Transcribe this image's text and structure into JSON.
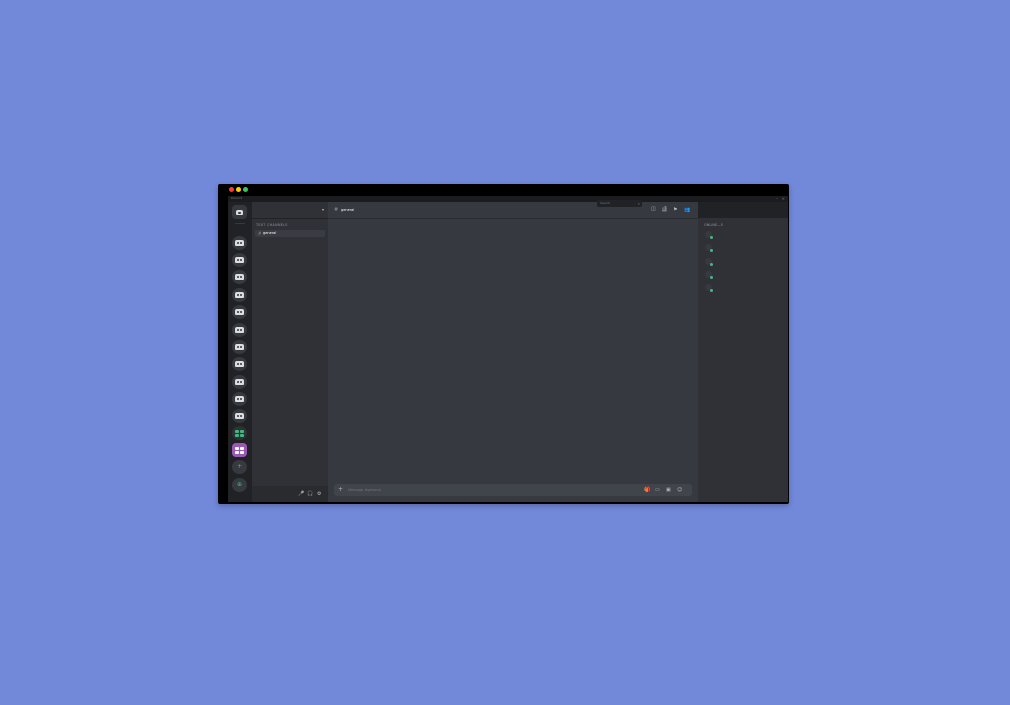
{
  "window": {
    "title": "Discord",
    "min_glyph": "–",
    "close_glyph": "×"
  },
  "guild_rail": {
    "home_icon": "discord-logo-icon",
    "guilds": [
      "server-1",
      "server-2",
      "server-3",
      "server-4",
      "server-5",
      "server-6",
      "server-7",
      "server-8",
      "server-9",
      "server-10",
      "server-11"
    ],
    "add_glyph": "+",
    "discover_glyph": "⊕"
  },
  "channels": {
    "chevron": "▾",
    "category": "TEXT CHANNELS",
    "selected_channel": "general",
    "hash": "#",
    "user_controls": [
      "🎤",
      "🎧",
      "⚙"
    ]
  },
  "chat": {
    "channel_name": "general",
    "hash": "#",
    "toolbar_icons": [
      "▤",
      "⚑",
      "👥"
    ],
    "search_placeholder": "Search",
    "search_glyph": "⌕",
    "inbox_glyph": "◫",
    "help_glyph": "?",
    "composer_plus": "+",
    "composer_placeholder": "Message #general",
    "composer_icons": [
      "🎁",
      "▭",
      "▣",
      "☺"
    ]
  },
  "members": {
    "heading": "ONLINE—5",
    "status_color": "#43b581",
    "list": [
      "",
      "",
      "",
      "",
      ""
    ]
  },
  "colors": {
    "background": "#7289da",
    "rail": "#202225",
    "sidebar": "#2f3136",
    "chat": "#36393f",
    "accent_green": "#43b581"
  }
}
